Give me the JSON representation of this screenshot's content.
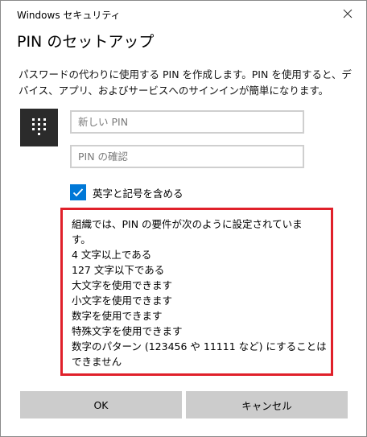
{
  "window": {
    "app_title": "Windows セキュリティ",
    "close_icon": "close-icon"
  },
  "dialog": {
    "title": "PIN のセットアップ",
    "description": "パスワードの代わりに使用する PIN を作成します。PIN を使用すると、デバイス、アプリ、およびサービスへのサインインが簡単になります。"
  },
  "pin_icon": "keypad-icon",
  "fields": {
    "new_pin": {
      "value": "",
      "placeholder": "新しい PIN"
    },
    "confirm_pin": {
      "value": "",
      "placeholder": "PIN の確認"
    }
  },
  "options": {
    "include_letters_symbols": {
      "label": "英字と記号を含める",
      "checked": true
    }
  },
  "requirements": {
    "lines": [
      "組織では、PIN の要件が次のように設定されていま",
      "す。",
      "4 文字以上である",
      "127 文字以下である",
      "大文字を使用できます",
      "小文字を使用できます",
      "数字を使用できます",
      "特殊文字を使用できます",
      "数字のパターン (123456 や 11111 など) にすることは",
      "できません"
    ]
  },
  "buttons": {
    "ok": "OK",
    "cancel": "キャンセル"
  },
  "colors": {
    "accent": "#0078d7",
    "highlight_border": "#e0202a",
    "icon_background": "#2b2b2b",
    "button_background": "#cccccc"
  }
}
